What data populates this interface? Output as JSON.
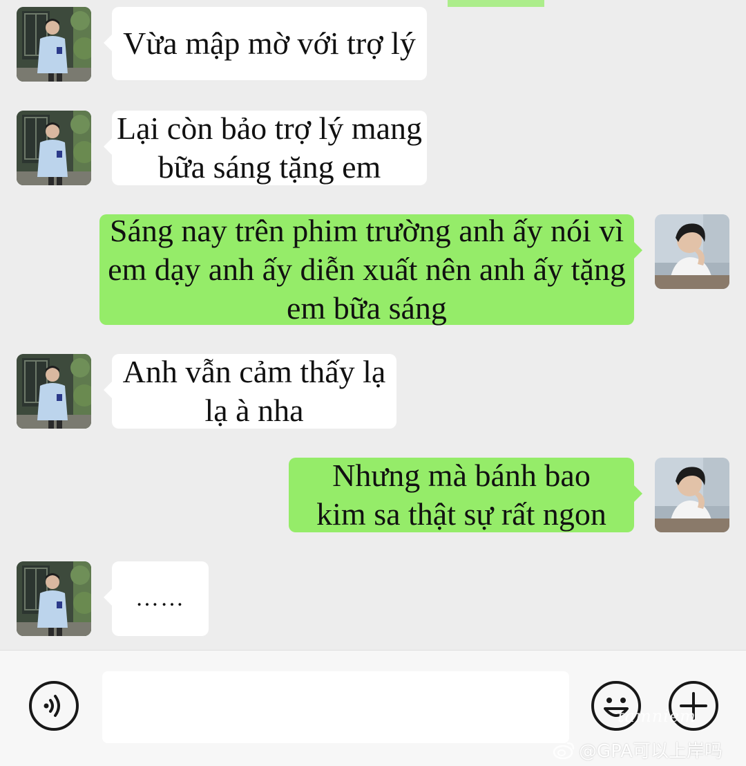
{
  "messages": [
    {
      "side": "in",
      "text": "Vừa mập mờ với trợ lý"
    },
    {
      "side": "in",
      "text": "Lại còn bảo trợ lý mang\nbữa sáng tặng em"
    },
    {
      "side": "out",
      "text": "Sáng nay trên phim trường anh ấy nói vì\nem dạy anh ấy diễn xuất nên anh ấy tặng\nem bữa sáng"
    },
    {
      "side": "in",
      "text": "Anh vẫn cảm thấy lạ\nlạ à nha"
    },
    {
      "side": "out",
      "text": "Nhưng mà bánh bao\nkim sa thật sự rất ngon"
    },
    {
      "side": "in",
      "text": "……"
    }
  ],
  "footer": {
    "voice_icon": "voice-icon",
    "emoji_icon": "emoji-icon",
    "plus_icon": "plus-icon"
  },
  "watermark": {
    "script": "tamniem",
    "handle": "@GPA可以上岸吗"
  },
  "colors": {
    "background": "#ededed",
    "incoming_bubble": "#ffffff",
    "outgoing_bubble": "#95ec69"
  }
}
